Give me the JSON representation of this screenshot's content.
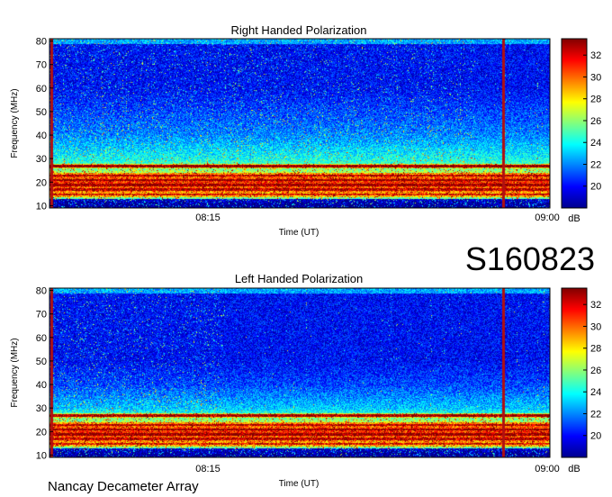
{
  "stamp": "S160823",
  "footer": "Nancay Decameter Array",
  "colormap": "jet",
  "colors": {
    "spectrogram_background": "#1a5fe0",
    "interference_band": "#c8141e",
    "sweep_line": "#b01010"
  },
  "chart_data": [
    {
      "type": "heatmap",
      "title": "Right Handed Polarization",
      "xlabel": "Time (UT)",
      "ylabel": "Frequency (MHz)",
      "x_ticklabels": [
        "08:15",
        "09:00"
      ],
      "y_ticks": [
        10,
        20,
        30,
        40,
        50,
        60,
        70,
        80
      ],
      "ylim": [
        9,
        81
      ],
      "colorbar": {
        "label": "dB",
        "ticks": [
          20,
          22,
          24,
          26,
          28,
          30,
          32
        ],
        "range": [
          18,
          33.5
        ]
      },
      "features": {
        "strong_bands_mhz": [
          27,
          23,
          21,
          19,
          17,
          15
        ],
        "background_db_by_freq": [
          [
            10,
            24
          ],
          [
            15,
            26
          ],
          [
            20,
            28
          ],
          [
            25,
            26
          ],
          [
            30,
            24
          ],
          [
            40,
            22
          ],
          [
            50,
            21
          ],
          [
            60,
            20
          ],
          [
            70,
            20
          ],
          [
            80,
            20
          ]
        ],
        "bursty_activity_until_fraction": 0.85
      }
    },
    {
      "type": "heatmap",
      "title": "Left Handed Polarization",
      "xlabel": "Time (UT)",
      "ylabel": "Frequency (MHz)",
      "x_ticklabels": [
        "08:15",
        "09:00"
      ],
      "y_ticks": [
        10,
        20,
        30,
        40,
        50,
        60,
        70,
        80
      ],
      "ylim": [
        9,
        81
      ],
      "colorbar": {
        "label": "dB",
        "ticks": [
          20,
          22,
          24,
          26,
          28,
          30,
          32
        ],
        "range": [
          18,
          33.5
        ]
      },
      "features": {
        "strong_bands_mhz": [
          27,
          23,
          21,
          19,
          17,
          15
        ],
        "background_db_by_freq": [
          [
            10,
            24
          ],
          [
            15,
            26
          ],
          [
            20,
            28
          ],
          [
            25,
            26
          ],
          [
            30,
            23
          ],
          [
            40,
            21
          ],
          [
            50,
            20
          ],
          [
            60,
            20
          ],
          [
            70,
            20
          ],
          [
            80,
            20
          ]
        ],
        "bursty_activity_until_fraction": 0.35
      }
    }
  ]
}
